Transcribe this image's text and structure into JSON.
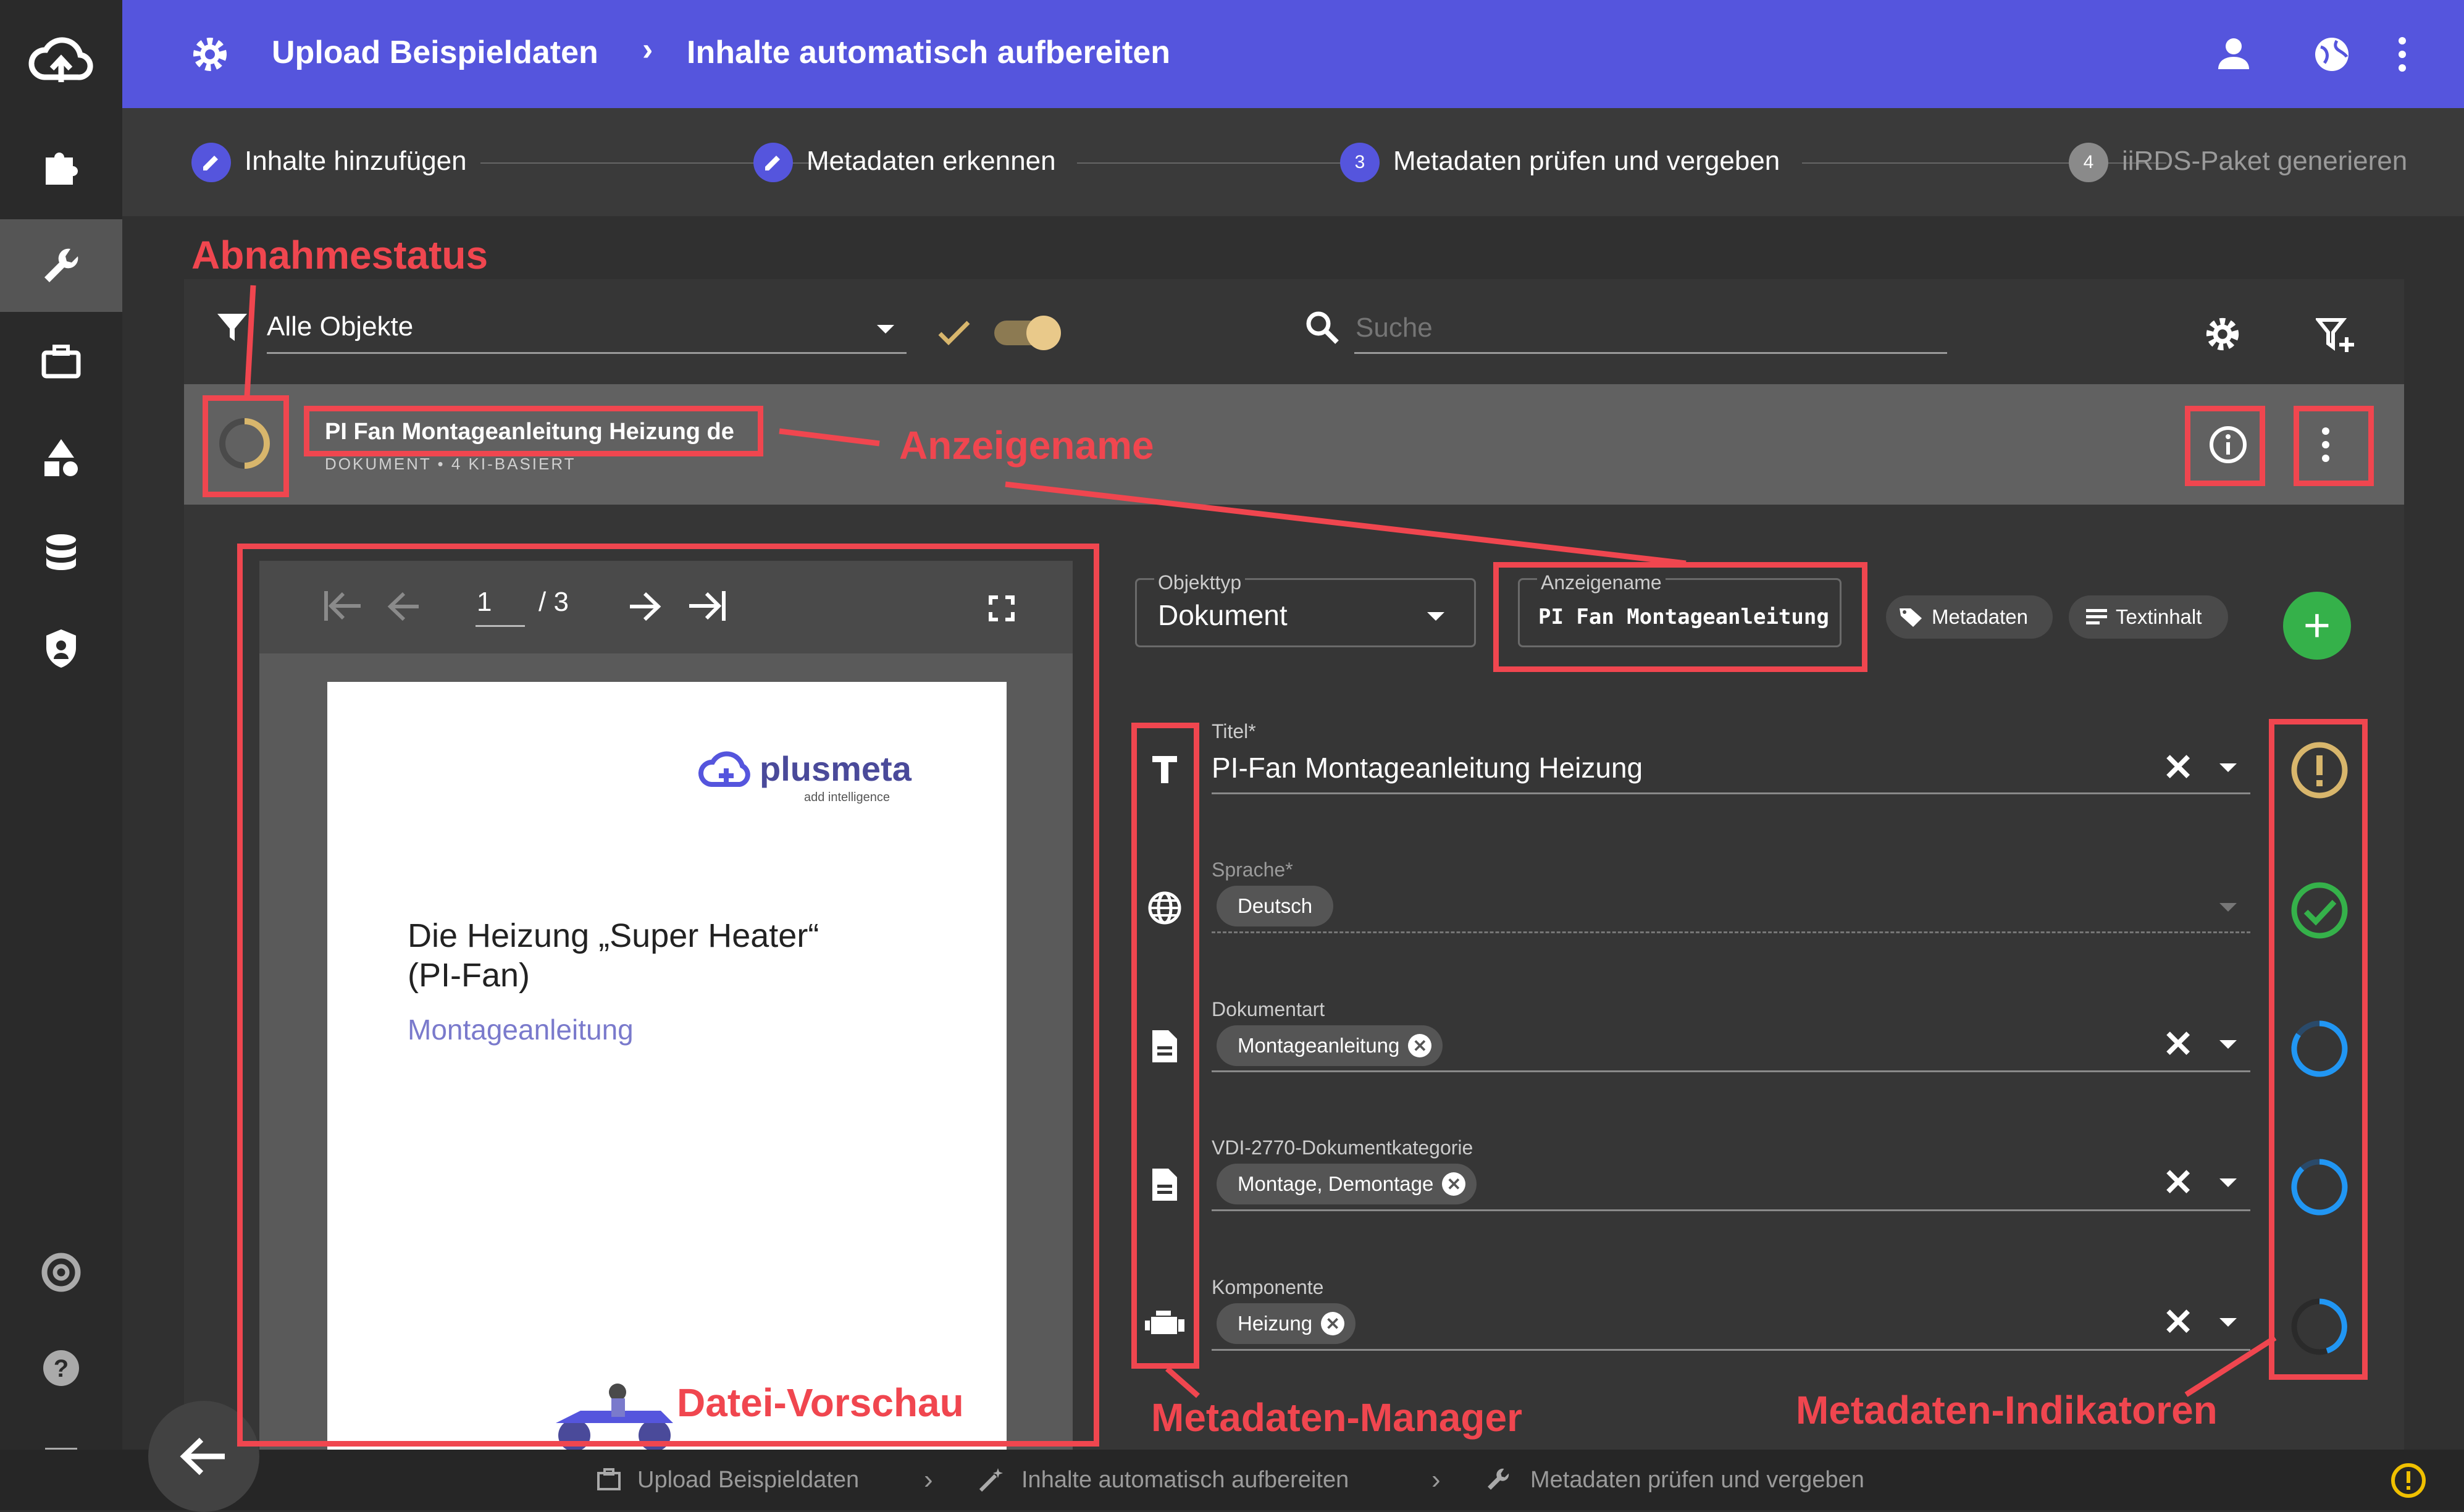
{
  "app": {
    "breadcrumb": [
      "Upload Beispieldaten",
      "Inhalte automatisch aufbereiten"
    ],
    "breadcrumb_sep": "›"
  },
  "stepper": [
    {
      "label": "Inhalte hinzufügen",
      "state": "done"
    },
    {
      "label": "Metadaten erkennen",
      "state": "done"
    },
    {
      "num": "3",
      "label": "Metadaten prüfen und vergeben",
      "state": "active"
    },
    {
      "num": "4",
      "label": "iiRDS-Paket generieren",
      "state": "pending"
    }
  ],
  "filter": {
    "value": "Alle Objekte",
    "toggle_on": true
  },
  "search": {
    "placeholder": "Suche"
  },
  "item": {
    "title": "PI Fan Montageanleitung Heizung de",
    "subtitle": "DOKUMENT • 4 KI-BASIERT"
  },
  "viewer": {
    "page": "1",
    "total": "/ 3"
  },
  "preview": {
    "logo_text": "plusmeta",
    "logo_tagline": "add intelligence",
    "heading_line1": "Die Heizung „Super Heater“",
    "heading_line2": "(PI-Fan)",
    "subtitle": "Montageanleitung"
  },
  "metadata": {
    "objekttyp_label": "Objekttyp",
    "objekttyp_value": "Dokument",
    "anzeigename_label": "Anzeigename",
    "anzeigename_value": "PI Fan Montageanleitung",
    "tabs": [
      "Metadaten",
      "Textinhalt"
    ],
    "add_symbol": "+",
    "fields": [
      {
        "label": "Titel*",
        "value": "PI-Fan Montageanleitung Heizung",
        "indicator": "warning"
      },
      {
        "label": "Sprache*",
        "chips": [
          "Deutsch"
        ],
        "indicator": "ok"
      },
      {
        "label": "Dokumentart",
        "chips": [
          "Montageanleitung"
        ],
        "indicator": "ai-progress"
      },
      {
        "label": "VDI-2770-Dokumentkategorie",
        "chips": [
          "Montage, Demontage"
        ],
        "indicator": "ai-progress"
      },
      {
        "label": "Komponente",
        "chips": [
          "Heizung"
        ],
        "indicator": "ai-partial"
      }
    ]
  },
  "annotations": {
    "abnahmestatus": "Abnahmestatus",
    "anzeigename": "Anzeigename",
    "datei_vorschau": "Datei-Vorschau",
    "metadaten_manager": "Metadaten-Manager",
    "metadaten_indikatoren": "Metadaten-Indikatoren"
  },
  "statusbar": {
    "crumbs": [
      "Upload Beispieldaten",
      "Inhalte automatisch aufbereiten",
      "Metadaten prüfen und vergeben"
    ],
    "sep": "›"
  },
  "colors": {
    "primary": "#5555dd",
    "annotation": "#f0464f",
    "ok": "#35b14a",
    "warning": "#d8b66c",
    "ai": "#2196f3"
  }
}
